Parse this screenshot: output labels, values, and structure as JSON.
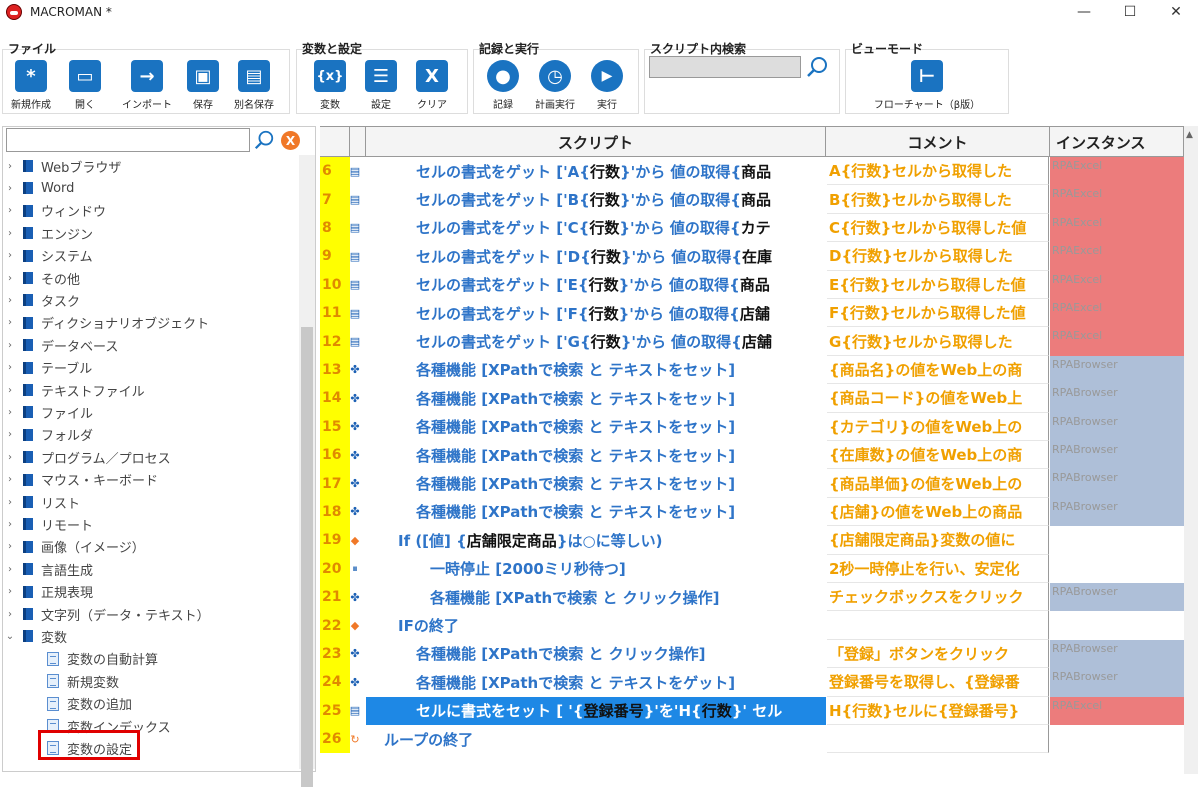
{
  "window": {
    "title": "MACROMAN *",
    "minimize": "—",
    "maximize": "☐",
    "close": "✕"
  },
  "ribbon": {
    "file": {
      "title": "ファイル",
      "buttons": [
        {
          "label": "新規作成",
          "glyph": "*"
        },
        {
          "label": "開く",
          "glyph": "▭"
        },
        {
          "label": "インポート",
          "glyph": "→"
        },
        {
          "label": "保存",
          "glyph": "▣"
        },
        {
          "label": "別名保存",
          "glyph": "▤"
        }
      ]
    },
    "vars": {
      "title": "変数と設定",
      "buttons": [
        {
          "label": "変数",
          "glyph": "{x}"
        },
        {
          "label": "設定",
          "glyph": "☰"
        },
        {
          "label": "クリア",
          "glyph": "X"
        }
      ]
    },
    "record": {
      "title": "記録と実行",
      "buttons": [
        {
          "label": "記録",
          "glyph": "●"
        },
        {
          "label": "計画実行",
          "glyph": "◷"
        },
        {
          "label": "実行",
          "glyph": "▶"
        }
      ]
    },
    "search": {
      "title": "スクリプト内検索",
      "placeholder": ""
    },
    "view": {
      "title": "ビューモード",
      "buttons": [
        {
          "label": "フローチャート（β版）",
          "glyph": "⊢"
        }
      ]
    }
  },
  "tree": {
    "search_value": "",
    "items": [
      {
        "label": "Webブラウザ"
      },
      {
        "label": "Word"
      },
      {
        "label": "ウィンドウ"
      },
      {
        "label": "エンジン"
      },
      {
        "label": "システム"
      },
      {
        "label": "その他"
      },
      {
        "label": "タスク"
      },
      {
        "label": "ディクショナリオブジェクト"
      },
      {
        "label": "データベース"
      },
      {
        "label": "テーブル"
      },
      {
        "label": "テキストファイル"
      },
      {
        "label": "ファイル"
      },
      {
        "label": "フォルダ"
      },
      {
        "label": "プログラム／プロセス"
      },
      {
        "label": "マウス・キーボード"
      },
      {
        "label": "リスト"
      },
      {
        "label": "リモート"
      },
      {
        "label": "画像（イメージ）"
      },
      {
        "label": "言語生成"
      },
      {
        "label": "正規表現"
      },
      {
        "label": "文字列（データ・テキスト）"
      },
      {
        "label": "変数"
      }
    ],
    "children": [
      {
        "label": "変数の自動計算"
      },
      {
        "label": "新規変数"
      },
      {
        "label": "変数の追加"
      },
      {
        "label": "変数インデックス"
      },
      {
        "label": "変数の設定"
      }
    ]
  },
  "grid": {
    "headers": {
      "script": "スクリプト",
      "comment": "コメント",
      "instance": "インスタンス"
    },
    "rows": [
      {
        "num": "6",
        "icon": "▤",
        "parts": [
          [
            "セルの書式をゲット ['A{",
            0
          ],
          [
            "行数",
            1
          ],
          [
            "}'から 値の取得{",
            0
          ],
          [
            "商品",
            1
          ]
        ],
        "comment": "A{行数}セルから取得した",
        "inst": "RPAExcel",
        "color": "#ec7c7c"
      },
      {
        "num": "7",
        "icon": "▤",
        "parts": [
          [
            "セルの書式をゲット ['B{",
            0
          ],
          [
            "行数",
            1
          ],
          [
            "}'から 値の取得{",
            0
          ],
          [
            "商品",
            1
          ]
        ],
        "comment": "B{行数}セルから取得した",
        "inst": "RPAExcel",
        "color": "#ec7c7c"
      },
      {
        "num": "8",
        "icon": "▤",
        "parts": [
          [
            "セルの書式をゲット ['C{",
            0
          ],
          [
            "行数",
            1
          ],
          [
            "}'から 値の取得{",
            0
          ],
          [
            "カテ",
            1
          ]
        ],
        "comment": "C{行数}セルから取得した値",
        "inst": "RPAExcel",
        "color": "#ec7c7c"
      },
      {
        "num": "9",
        "icon": "▤",
        "parts": [
          [
            "セルの書式をゲット ['D{",
            0
          ],
          [
            "行数",
            1
          ],
          [
            "}'から 値の取得{",
            0
          ],
          [
            "在庫",
            1
          ]
        ],
        "comment": "D{行数}セルから取得した",
        "inst": "RPAExcel",
        "color": "#ec7c7c"
      },
      {
        "num": "10",
        "icon": "▤",
        "parts": [
          [
            "セルの書式をゲット ['E{",
            0
          ],
          [
            "行数",
            1
          ],
          [
            "}'から 値の取得{",
            0
          ],
          [
            "商品",
            1
          ]
        ],
        "comment": "E{行数}セルから取得した値",
        "inst": "RPAExcel",
        "color": "#ec7c7c"
      },
      {
        "num": "11",
        "icon": "▤",
        "parts": [
          [
            "セルの書式をゲット ['F{",
            0
          ],
          [
            "行数",
            1
          ],
          [
            "}'から 値の取得{",
            0
          ],
          [
            "店舗",
            1
          ]
        ],
        "comment": "F{行数}セルから取得した値",
        "inst": "RPAExcel",
        "color": "#ec7c7c"
      },
      {
        "num": "12",
        "icon": "▤",
        "parts": [
          [
            "セルの書式をゲット ['G{",
            0
          ],
          [
            "行数",
            1
          ],
          [
            "}'から 値の取得{",
            0
          ],
          [
            "店舗",
            1
          ]
        ],
        "comment": "G{行数}セルから取得した",
        "inst": "RPAExcel",
        "color": "#ec7c7c"
      },
      {
        "num": "13",
        "icon": "✤",
        "parts": [
          [
            "各種機能 [XPathで検索 と テキストをセット]",
            0
          ]
        ],
        "comment": "{商品名}の値をWeb上の商",
        "inst": "RPABrowser",
        "color": "#aebfd8"
      },
      {
        "num": "14",
        "icon": "✤",
        "parts": [
          [
            "各種機能 [XPathで検索 と テキストをセット]",
            0
          ]
        ],
        "comment": "{商品コード}の値をWeb上",
        "inst": "RPABrowser",
        "color": "#aebfd8"
      },
      {
        "num": "15",
        "icon": "✤",
        "parts": [
          [
            "各種機能 [XPathで検索 と テキストをセット]",
            0
          ]
        ],
        "comment": "{カテゴリ}の値をWeb上の",
        "inst": "RPABrowser",
        "color": "#aebfd8"
      },
      {
        "num": "16",
        "icon": "✤",
        "parts": [
          [
            "各種機能 [XPathで検索 と テキストをセット]",
            0
          ]
        ],
        "comment": "{在庫数}の値をWeb上の商",
        "inst": "RPABrowser",
        "color": "#aebfd8"
      },
      {
        "num": "17",
        "icon": "✤",
        "parts": [
          [
            "各種機能 [XPathで検索 と テキストをセット]",
            0
          ]
        ],
        "comment": "{商品単価}の値をWeb上の",
        "inst": "RPABrowser",
        "color": "#aebfd8"
      },
      {
        "num": "18",
        "icon": "✤",
        "parts": [
          [
            "各種機能 [XPathで検索 と テキストをセット]",
            0
          ]
        ],
        "comment": "{店舗}の値をWeb上の商品",
        "inst": "RPABrowser",
        "color": "#aebfd8"
      },
      {
        "num": "19",
        "icon": "◆",
        "parts": [
          [
            "If ([値] {",
            0
          ],
          [
            "店舗限定商品",
            1
          ],
          [
            "}は○に等しい)",
            0
          ]
        ],
        "comment": "{店舗限定商品}変数の値に",
        "inst": "",
        "color": ""
      },
      {
        "num": "20",
        "icon": "⏸",
        "parts": [
          [
            "一時停止 [2000ミリ秒待つ]",
            0
          ]
        ],
        "comment": "2秒一時停止を行い、安定化",
        "inst": "",
        "color": ""
      },
      {
        "num": "21",
        "icon": "✤",
        "parts": [
          [
            "各種機能 [XPathで検索 と クリック操作]",
            0
          ]
        ],
        "comment": "チェックボックスをクリック",
        "inst": "RPABrowser",
        "color": "#aebfd8"
      },
      {
        "num": "22",
        "icon": "◆",
        "parts": [
          [
            "IFの終了",
            0
          ]
        ],
        "comment": "",
        "inst": "",
        "color": ""
      },
      {
        "num": "23",
        "icon": "✤",
        "parts": [
          [
            "各種機能 [XPathで検索 と クリック操作]",
            0
          ]
        ],
        "comment": "「登録」ボタンをクリック",
        "inst": "RPABrowser",
        "color": "#aebfd8"
      },
      {
        "num": "24",
        "icon": "✤",
        "parts": [
          [
            "各種機能 [XPathで検索 と テキストをゲット]",
            0
          ]
        ],
        "comment": "登録番号を取得し、{登録番",
        "inst": "RPABrowser",
        "color": "#aebfd8"
      },
      {
        "num": "25",
        "icon": "▤",
        "parts": [
          [
            "セルに書式をセット [ '{",
            0
          ],
          [
            "登録番号",
            1
          ],
          [
            "}'を'H{",
            0
          ],
          [
            "行数",
            1
          ],
          [
            "}' セル",
            0
          ]
        ],
        "comment": "H{行数}セルに{登録番号}",
        "inst": "RPAExcel",
        "color": "#ec7c7c"
      },
      {
        "num": "26",
        "icon": "↻",
        "parts": [
          [
            "ループの終了",
            0
          ]
        ],
        "comment": "",
        "inst": "",
        "color": ""
      }
    ]
  }
}
